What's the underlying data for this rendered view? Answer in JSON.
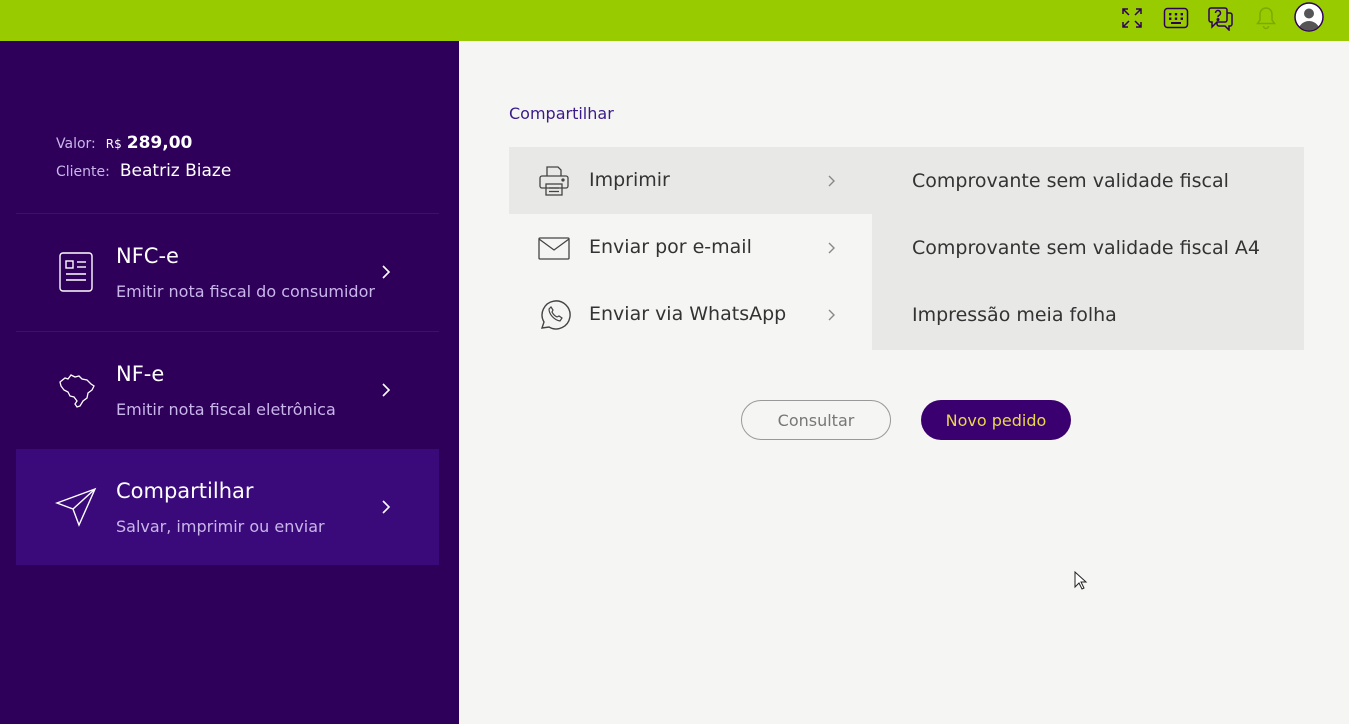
{
  "topbar": {
    "icons": [
      "expand-icon",
      "keypad-icon",
      "help-icon",
      "bell-icon",
      "user-avatar-icon"
    ]
  },
  "summary": {
    "valor_label": "Valor:",
    "currency": "R$",
    "valor": "289,00",
    "cliente_label": "Cliente:",
    "cliente": "Beatriz Biaze"
  },
  "nav": {
    "items": [
      {
        "title": "NFC-e",
        "subtitle": "Emitir nota fiscal do consumidor",
        "icon": "receipt-icon"
      },
      {
        "title": "NF-e",
        "subtitle": "Emitir nota fiscal eletrônica",
        "icon": "brazil-map-icon"
      },
      {
        "title": "Compartilhar",
        "subtitle": "Salvar, imprimir ou enviar",
        "icon": "paper-plane-icon"
      }
    ]
  },
  "main": {
    "section_title": "Compartilhar",
    "menu": [
      {
        "label": "Imprimir",
        "icon": "printer-icon"
      },
      {
        "label": "Enviar por e-mail",
        "icon": "envelope-icon"
      },
      {
        "label": "Enviar via WhatsApp",
        "icon": "whatsapp-icon"
      }
    ],
    "submenu": [
      {
        "label": "Comprovante sem validade fiscal"
      },
      {
        "label": "Comprovante sem validade fiscal A4"
      },
      {
        "label": "Impressão meia folha"
      }
    ],
    "consultar_label": "Consultar",
    "novo_pedido_label": "Novo pedido"
  },
  "colors": {
    "topbar": "#99cc00",
    "sidebar": "#2e005a",
    "sidebar_active": "#3a0a7a",
    "primary_button": "#3a0070",
    "primary_button_text": "#e8d84a"
  }
}
